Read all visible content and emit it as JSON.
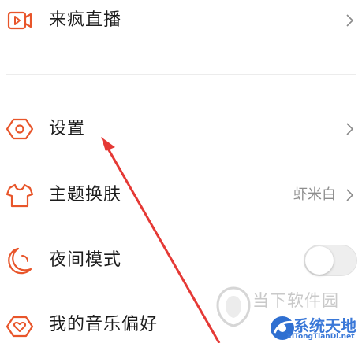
{
  "colors": {
    "accent": "#e8552a",
    "arrow": "#e53935",
    "label": "#1c1c1c",
    "value": "#8e8e8e"
  },
  "menu": {
    "live": {
      "label": "来疯直播",
      "icon": "video-play-icon"
    },
    "settings": {
      "label": "设置",
      "icon": "hexagon-settings-icon"
    },
    "theme": {
      "label": "主题换肤",
      "value": "虾米白",
      "icon": "tshirt-icon"
    },
    "night": {
      "label": "夜间模式",
      "icon": "moon-icon",
      "toggle_on": false
    },
    "music_pref": {
      "label": "我的音乐偏好",
      "icon": "heart-tag-icon"
    }
  },
  "watermark": {
    "line1": "当下软件园",
    "line2": "系统天地",
    "line3": "XiTongTianDi.net"
  }
}
